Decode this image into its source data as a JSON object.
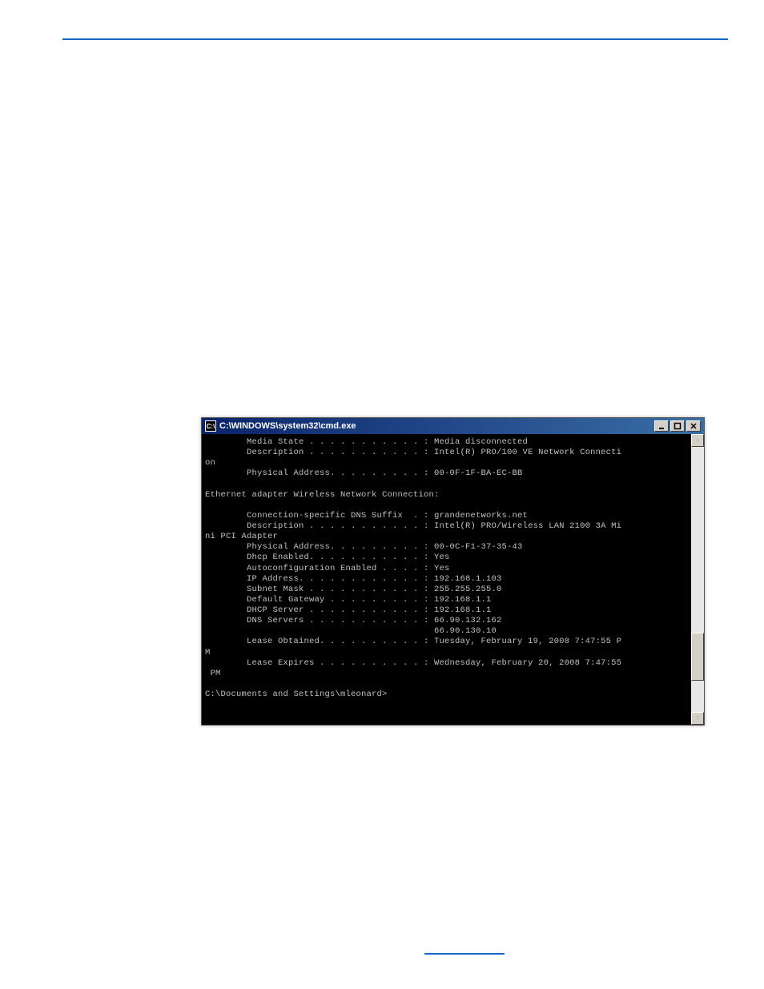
{
  "top_rule": true,
  "bottom_link_rule": true,
  "window": {
    "title": "C:\\WINDOWS\\system32\\cmd.exe",
    "icon_glyph": "C:\\",
    "buttons": {
      "minimize": "_",
      "maximize": "□",
      "close": "×"
    }
  },
  "terminal_lines": [
    "        Media State . . . . . . . . . . . : Media disconnected",
    "        Description . . . . . . . . . . . : Intel(R) PRO/100 VE Network Connecti",
    "on",
    "        Physical Address. . . . . . . . . : 00-0F-1F-BA-EC-BB",
    "",
    "Ethernet adapter Wireless Network Connection:",
    "",
    "        Connection-specific DNS Suffix  . : grandenetworks.net",
    "        Description . . . . . . . . . . . : Intel(R) PRO/Wireless LAN 2100 3A Mi",
    "ni PCI Adapter",
    "        Physical Address. . . . . . . . . : 00-0C-F1-37-35-43",
    "        Dhcp Enabled. . . . . . . . . . . : Yes",
    "        Autoconfiguration Enabled . . . . : Yes",
    "        IP Address. . . . . . . . . . . . : 192.168.1.103",
    "        Subnet Mask . . . . . . . . . . . : 255.255.255.0",
    "        Default Gateway . . . . . . . . . : 192.168.1.1",
    "        DHCP Server . . . . . . . . . . . : 192.168.1.1",
    "        DNS Servers . . . . . . . . . . . : 66.90.132.162",
    "                                            66.90.130.10",
    "        Lease Obtained. . . . . . . . . . : Tuesday, February 19, 2008 7:47:55 P",
    "M",
    "        Lease Expires . . . . . . . . . . : Wednesday, February 20, 2008 7:47:55",
    " PM",
    "",
    "C:\\Documents and Settings\\mleonard>"
  ],
  "scrollbar": {
    "up": "▲",
    "down": "▼"
  }
}
